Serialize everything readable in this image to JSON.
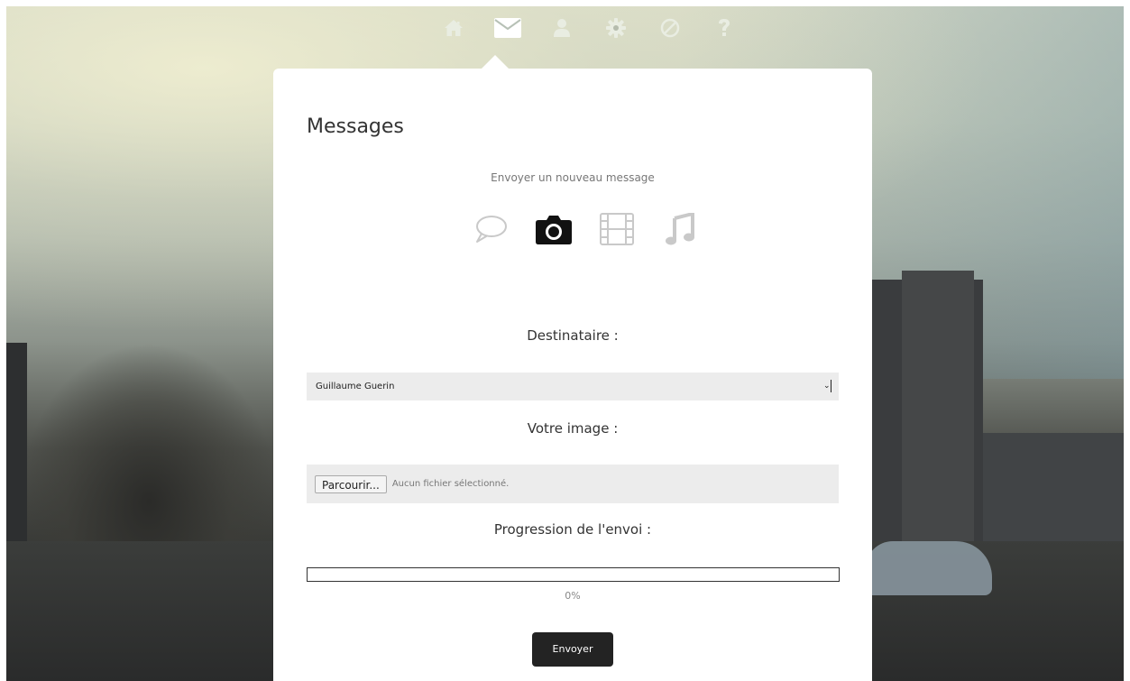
{
  "nav": {
    "items": [
      {
        "icon": "home-icon",
        "active": false
      },
      {
        "icon": "envelope-icon",
        "active": true
      },
      {
        "icon": "user-icon",
        "active": false
      },
      {
        "icon": "gear-icon",
        "active": false
      },
      {
        "icon": "block-icon",
        "active": false
      },
      {
        "icon": "question-icon",
        "active": false
      }
    ]
  },
  "panel": {
    "title": "Messages",
    "subtitle": "Envoyer un nouveau message",
    "message_types": [
      {
        "icon": "speech-bubble-icon",
        "active": false
      },
      {
        "icon": "camera-icon",
        "active": true
      },
      {
        "icon": "film-icon",
        "active": false
      },
      {
        "icon": "music-note-icon",
        "active": false
      }
    ],
    "recipient_label": "Destinataire :",
    "recipient_value": "Guillaume Guerin",
    "image_label": "Votre image :",
    "browse_button": "Parcourir...",
    "file_status": "Aucun fichier sélectionné.",
    "progress_label": "Progression de l'envoi :",
    "progress_value": 0,
    "progress_text": "0%",
    "send_button": "Envoyer"
  },
  "colors": {
    "nav_active": "#ffffff",
    "nav_inactive": "#e9ede2",
    "icon_active": "#111111",
    "icon_inactive": "#c9c9c9",
    "button_dark": "#232323"
  }
}
